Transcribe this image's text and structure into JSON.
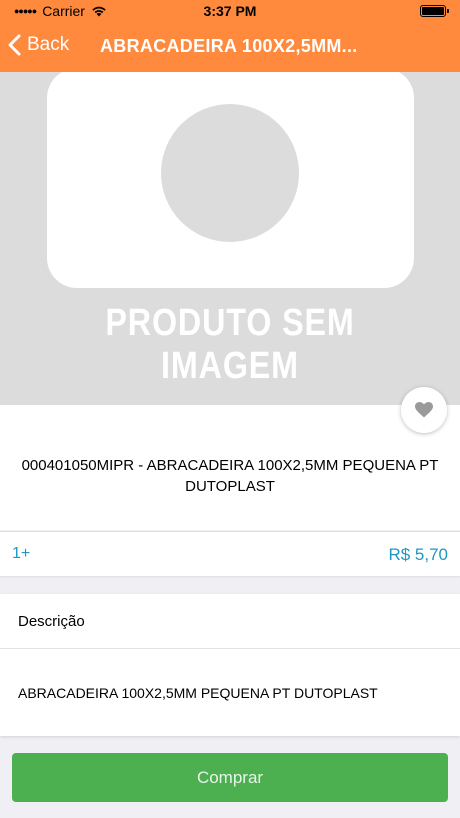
{
  "status_bar": {
    "carrier": "Carrier",
    "time": "3:37 PM",
    "icons": [
      "signal-dots-icon",
      "wifi-icon",
      "battery-icon"
    ]
  },
  "nav": {
    "back_label": "Back",
    "title": "ABRACADEIRA 100X2,5MM..."
  },
  "image": {
    "placeholder_text": "PRODUTO SEM IMAGEM"
  },
  "favorite": {
    "icon": "heart-icon"
  },
  "product": {
    "name": "000401050MIPR - ABRACADEIRA 100X2,5MM PEQUENA PT DUTOPLAST"
  },
  "pricing": {
    "quantity": "1+",
    "price": "R$ 5,70"
  },
  "description": {
    "title": "Descrição",
    "text": "ABRACADEIRA 100X2,5MM PEQUENA PT DUTOPLAST"
  },
  "actions": {
    "buy_label": "Comprar"
  },
  "colors": {
    "header": "#ff8a3d",
    "price": "#2196c4",
    "buy_button": "#4caf50"
  }
}
